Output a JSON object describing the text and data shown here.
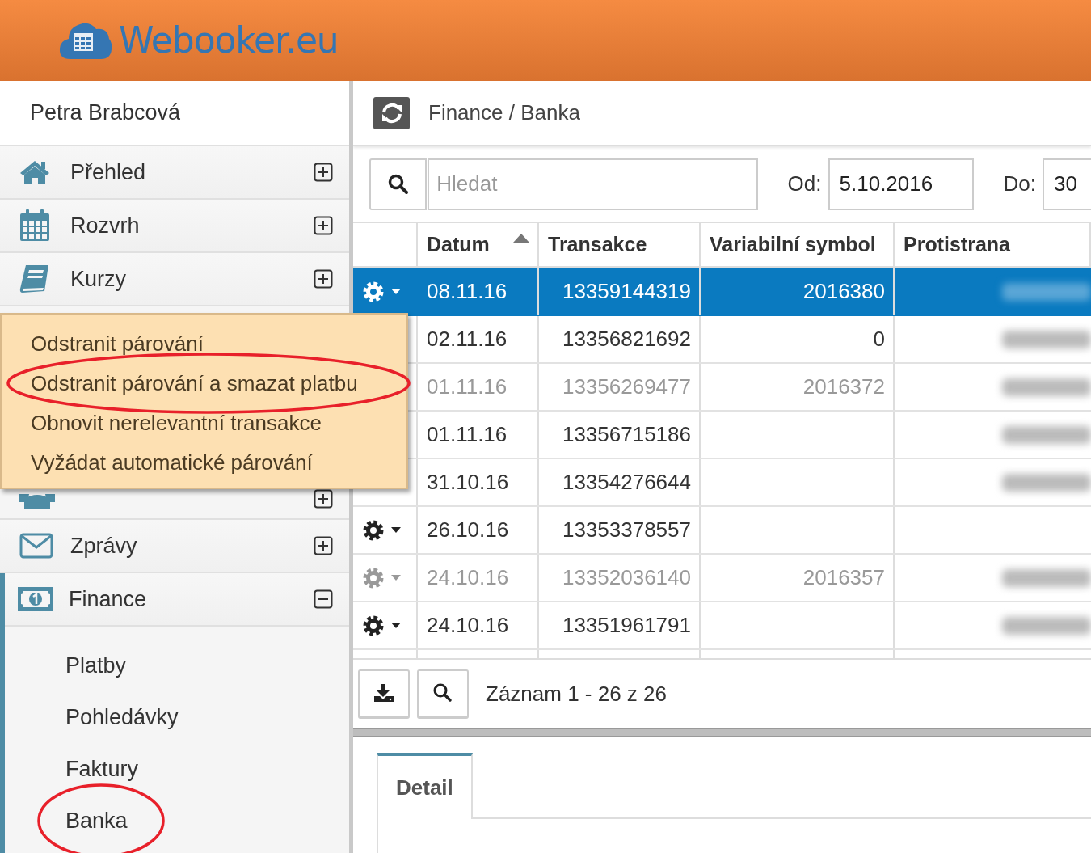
{
  "header": {
    "logo_text": "Webooker.eu"
  },
  "sidebar": {
    "user": "Petra Brabcová",
    "items": [
      {
        "label": "Přehled",
        "expanded": false
      },
      {
        "label": "Rozvrh",
        "expanded": false
      },
      {
        "label": "Kurzy",
        "expanded": false
      },
      {
        "label": "Zprávy",
        "expanded": false
      },
      {
        "label": "Finance",
        "expanded": true,
        "children": [
          {
            "label": "Platby",
            "circled": false
          },
          {
            "label": "Pohledávky",
            "circled": false
          },
          {
            "label": "Faktury",
            "circled": false
          },
          {
            "label": "Banka",
            "circled": true
          }
        ]
      }
    ]
  },
  "breadcrumb": "Finance / Banka",
  "filter": {
    "search_placeholder": "Hledat",
    "from_label": "Od:",
    "from_value": "5.10.2016",
    "to_label": "Do:",
    "to_value": "30"
  },
  "table": {
    "columns": [
      {
        "label": "Datum",
        "sorted": true
      },
      {
        "label": "Transakce",
        "sorted": false
      },
      {
        "label": "Variabilní symbol",
        "sorted": false
      },
      {
        "label": "Protistrana",
        "sorted": false
      }
    ],
    "rows": [
      {
        "selected": true,
        "muted": false,
        "gear_visible": true,
        "cells": [
          "08.11.16",
          "13359144319",
          "2016380"
        ],
        "redacted": true
      },
      {
        "selected": false,
        "muted": false,
        "gear_visible": false,
        "cells": [
          "02.11.16",
          "13356821692",
          "0"
        ],
        "redacted": true
      },
      {
        "selected": false,
        "muted": true,
        "gear_visible": false,
        "cells": [
          "01.11.16",
          "13356269477",
          "2016372"
        ],
        "redacted": true
      },
      {
        "selected": false,
        "muted": false,
        "gear_visible": false,
        "cells": [
          "01.11.16",
          "13356715186",
          ""
        ],
        "redacted": true
      },
      {
        "selected": false,
        "muted": false,
        "gear_visible": false,
        "cells": [
          "31.10.16",
          "13354276644",
          ""
        ],
        "redacted": true
      },
      {
        "selected": false,
        "muted": false,
        "gear_visible": true,
        "cells": [
          "26.10.16",
          "13353378557",
          ""
        ],
        "redacted": false
      },
      {
        "selected": false,
        "muted": true,
        "gear_visible": true,
        "cells": [
          "24.10.16",
          "13352036140",
          "2016357"
        ],
        "redacted": true
      },
      {
        "selected": false,
        "muted": false,
        "gear_visible": true,
        "cells": [
          "24.10.16",
          "13351961791",
          ""
        ],
        "redacted": true
      }
    ]
  },
  "footer": {
    "record_info": "Záznam 1 - 26 z 26"
  },
  "detail_tabs": [
    {
      "label": "Detail",
      "selected": true
    }
  ],
  "context_menu": {
    "items": [
      {
        "label": "Odstranit párování",
        "circled": false
      },
      {
        "label": "Odstranit párování a smazat platbu",
        "circled": true
      },
      {
        "label": "Obnovit nerelevantní transakce",
        "circled": false
      },
      {
        "label": "Vyžádat automatické párování",
        "circled": false
      }
    ]
  }
}
